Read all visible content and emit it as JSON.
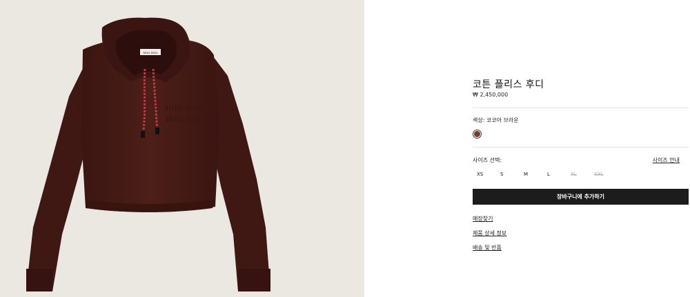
{
  "product": {
    "title": "코튼 플리스 후디",
    "price": "₩ 2,450,000",
    "image_label": "miu miu",
    "logo_text": "miu miu"
  },
  "color": {
    "label": "색상: 코코아 브라운",
    "swatch_hex": "#7a3a24"
  },
  "size": {
    "label": "사이즈 선택:",
    "guide_label": "사이즈 안내",
    "options": [
      {
        "label": "XS",
        "available": true
      },
      {
        "label": "S",
        "available": true
      },
      {
        "label": "M",
        "available": true
      },
      {
        "label": "L",
        "available": true
      },
      {
        "label": "XL",
        "available": false
      },
      {
        "label": "XXL",
        "available": false
      }
    ]
  },
  "cart": {
    "button_label": "장바구니에 추가하기"
  },
  "links": {
    "store": "매장찾기",
    "details": "제품 상세 정보",
    "shipping": "배송 및 반품"
  },
  "colors": {
    "garment": "#4a1d17",
    "background": "#ebe8e2",
    "button": "#1c1c1c"
  }
}
